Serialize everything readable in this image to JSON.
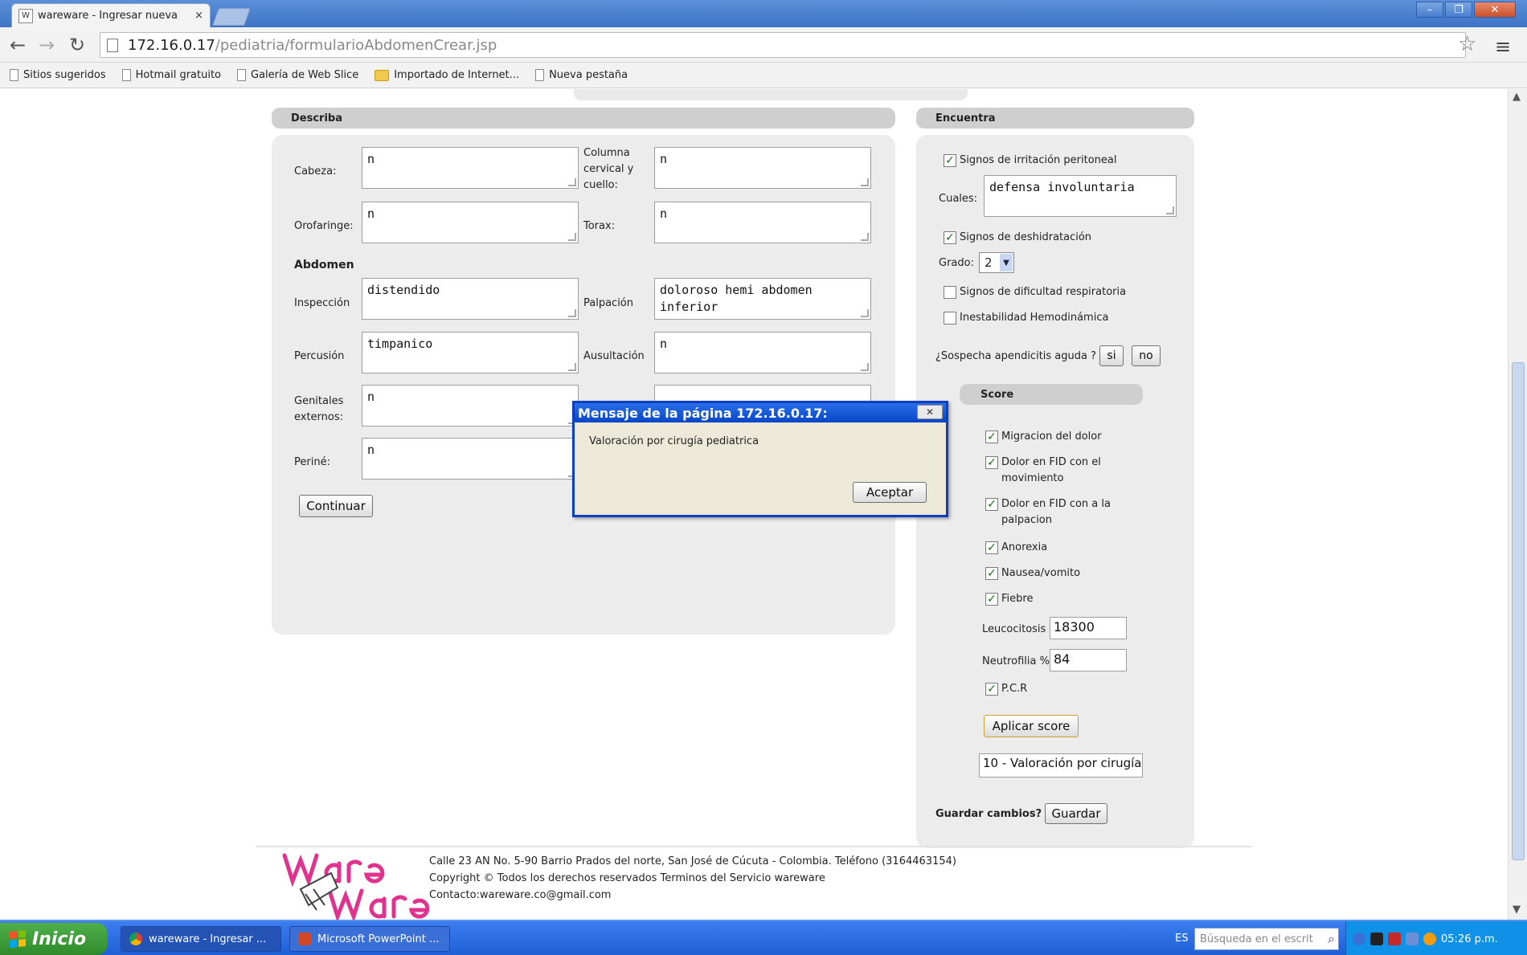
{
  "browser": {
    "tab_title": "wareware - Ingresar nueva",
    "tab_close": "×",
    "favicon": "W",
    "url_host": "172.16.0.17",
    "url_path": "/pediatria/formularioAbdomenCrear.jsp",
    "window_controls": [
      "–",
      "❐",
      "✕"
    ],
    "bookmarks": [
      "Sitios sugeridos",
      "Hotmail gratuito",
      "Galería de Web Slice",
      "Importado de Internet...",
      "Nueva pestaña"
    ]
  },
  "describa": {
    "header": "Describa",
    "fields": {
      "cabeza": {
        "label": "Cabeza:",
        "value": "n"
      },
      "columna": {
        "label": "Columna cervical y cuello:",
        "value": "n"
      },
      "orofaringe": {
        "label": "Orofaringe:",
        "value": "n"
      },
      "torax": {
        "label": "Torax:",
        "value": "n"
      },
      "inspeccion": {
        "label": "Inspección",
        "value": "distendido"
      },
      "palpacion": {
        "label": "Palpación",
        "value": "doloroso hemi abdomen inferior"
      },
      "percusion": {
        "label": "Percusión",
        "value": "timpanico"
      },
      "auscultacion": {
        "label": "Ausultación",
        "value": "n"
      },
      "genitales": {
        "label": "Genitales externos:",
        "value": "n"
      },
      "perine": {
        "label": "Periné:",
        "value": "n"
      }
    },
    "abdomen_title": "Abdomen",
    "continuar": "Continuar"
  },
  "encuentra": {
    "header": "Encuentra",
    "irritacion": {
      "label": "Signos de irritación peritoneal",
      "checked": true
    },
    "cuales_label": "Cuales:",
    "cuales_value": "defensa involuntaria",
    "deshidratacion": {
      "label": "Signos de deshidratación",
      "checked": true
    },
    "grado_label": "Grado:",
    "grado_value": "2",
    "dificultad": {
      "label": "Signos de dificultad respiratoria",
      "checked": false
    },
    "inestabilidad": {
      "label": "Inestabilidad Hemodinámica",
      "checked": false
    },
    "sospecha": "¿Sospecha apendicitis aguda ?",
    "si": "si",
    "no": "no",
    "score_header": "Score",
    "score_items": [
      {
        "label": "Migracion del dolor",
        "checked": true
      },
      {
        "label": "Dolor en FID con el movimiento",
        "checked": true
      },
      {
        "label": "Dolor en FID con a la palpacion",
        "checked": true
      },
      {
        "label": "Anorexia",
        "checked": true
      },
      {
        "label": "Nausea/vomito",
        "checked": true
      },
      {
        "label": "Fiebre",
        "checked": true
      }
    ],
    "leucocitosis_label": "Leucocitosis",
    "leucocitosis_value": "18300",
    "neutrofilia_label": "Neutrofilia %",
    "neutrofilia_value": "84",
    "pcr": {
      "label": "P.C.R",
      "checked": true
    },
    "aplicar": "Aplicar score",
    "resultado": "10 - Valoración por cirugía",
    "guardar_label": "Guardar cambios?",
    "guardar": "Guardar"
  },
  "footer": {
    "lines": [
      "Calle 23 AN No. 5-90 Barrio Prados del norte, San José de Cúcuta - Colombia. Teléfono (3164463154)",
      "Copyright © Todos los derechos reservados Terminos del Servicio wareware",
      "Contacto:wareware.co@gmail.com"
    ]
  },
  "dialog": {
    "title": "Mensaje de la página 172.16.0.17:",
    "message": "Valoración por cirugía pediatrica",
    "ok": "Aceptar",
    "close": "✕"
  },
  "taskbar": {
    "start": "Inicio",
    "tasks": [
      "wareware - Ingresar ...",
      "Microsoft PowerPoint ..."
    ],
    "lang": "ES",
    "search_placeholder": "Búsqueda en el escrit",
    "clock": "05:26 p.m."
  }
}
